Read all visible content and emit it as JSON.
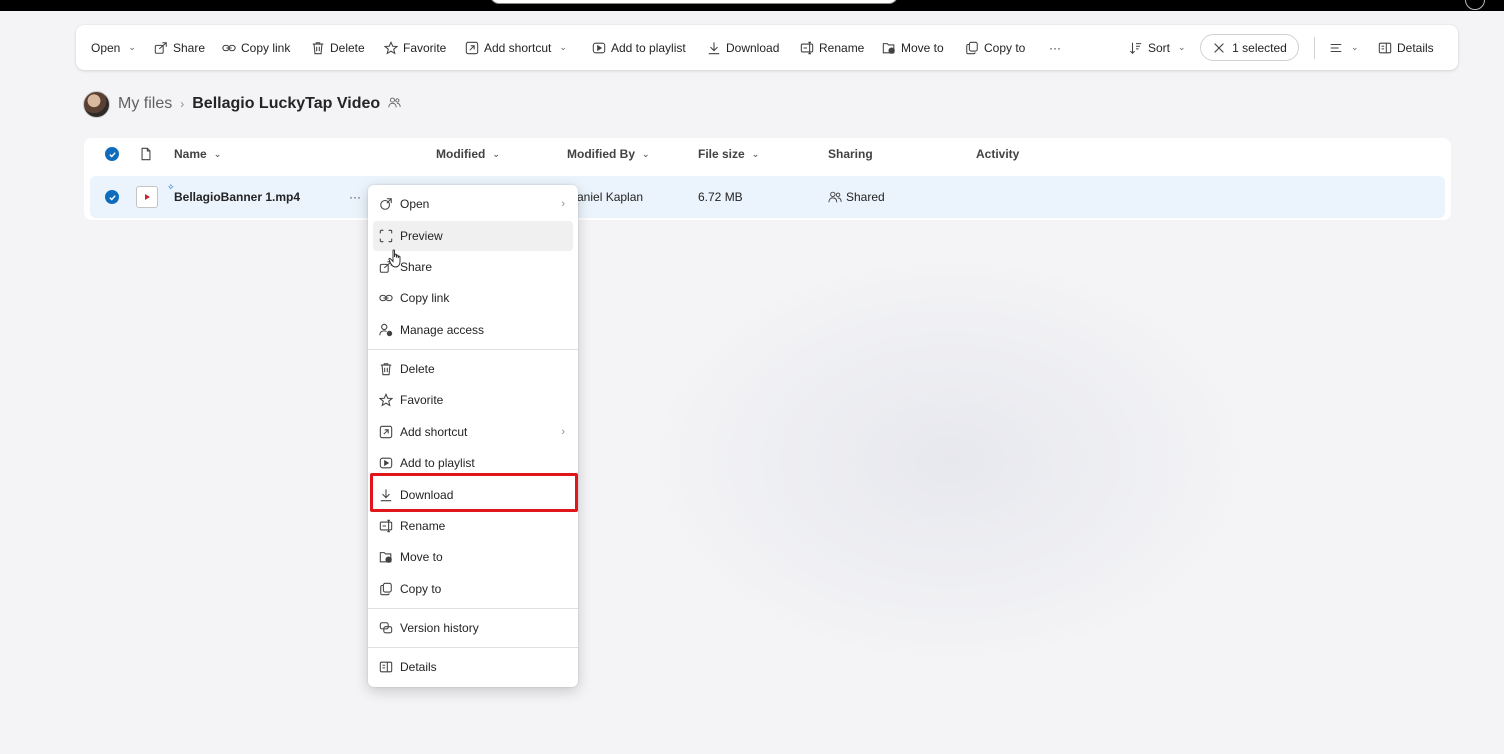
{
  "toolbar": {
    "open": "Open",
    "share": "Share",
    "copy_link": "Copy link",
    "delete": "Delete",
    "favorite": "Favorite",
    "add_shortcut": "Add shortcut",
    "add_to_playlist": "Add to playlist",
    "download": "Download",
    "rename": "Rename",
    "move_to": "Move to",
    "copy_to": "Copy to",
    "more": "···",
    "sort": "Sort",
    "selected": "1 selected",
    "details": "Details"
  },
  "breadcrumb": {
    "root": "My files",
    "separator": "›",
    "current": "Bellagio LuckyTap Video"
  },
  "list": {
    "columns": {
      "name": "Name",
      "modified": "Modified",
      "modified_by": "Modified By",
      "file_size": "File size",
      "sharing": "Sharing",
      "activity": "Activity"
    },
    "rows": [
      {
        "name": "BellagioBanner 1.mp4",
        "more": "···",
        "modified_by": "aniel Kaplan",
        "file_size": "6.72 MB",
        "sharing": "Shared"
      }
    ]
  },
  "context_menu": {
    "items": [
      {
        "label": "Open",
        "icon": "open-icon",
        "submenu": true
      },
      {
        "label": "Preview",
        "icon": "preview-icon"
      },
      {
        "label": "Share",
        "icon": "share-icon"
      },
      {
        "label": "Copy link",
        "icon": "link-icon"
      },
      {
        "label": "Manage access",
        "icon": "manage-access-icon"
      },
      {
        "label": "Delete",
        "icon": "trash-icon"
      },
      {
        "label": "Favorite",
        "icon": "star-icon"
      },
      {
        "label": "Add shortcut",
        "icon": "shortcut-icon",
        "submenu": true
      },
      {
        "label": "Add to playlist",
        "icon": "playlist-icon"
      },
      {
        "label": "Download",
        "icon": "download-icon"
      },
      {
        "label": "Rename",
        "icon": "rename-icon"
      },
      {
        "label": "Move to",
        "icon": "move-icon"
      },
      {
        "label": "Copy to",
        "icon": "copy-icon"
      },
      {
        "label": "Version history",
        "icon": "version-history-icon"
      },
      {
        "label": "Details",
        "icon": "details-icon"
      }
    ],
    "submenu_arrow": "›"
  },
  "colors": {
    "accent": "#0f6cbd",
    "selected_row": "#ebf3fc",
    "highlight_box": "#e0161d",
    "video_play": "#c4262e"
  }
}
